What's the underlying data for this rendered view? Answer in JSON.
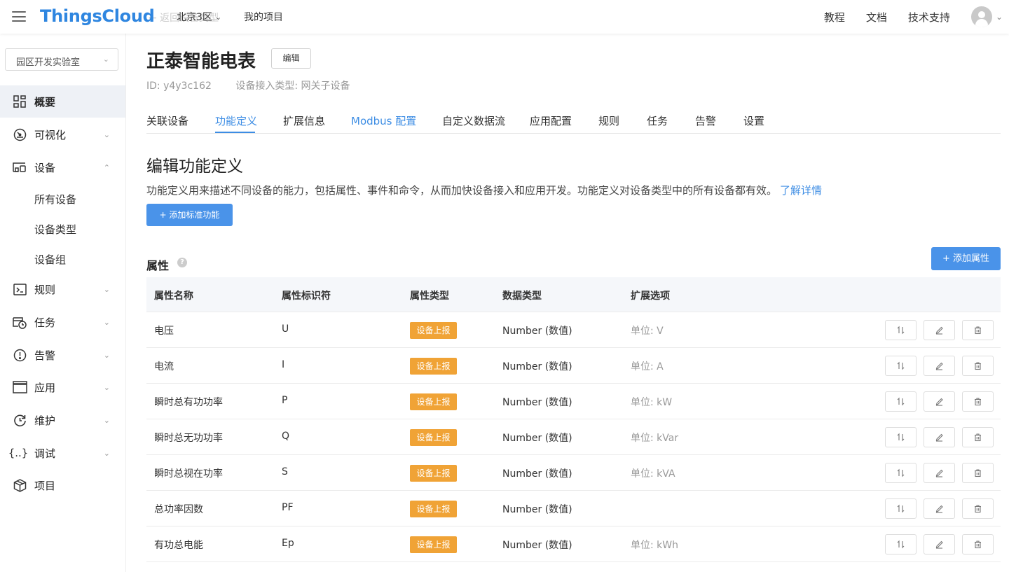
{
  "topbar": {
    "logo": "ThingsCloud",
    "back_text": "← 返回设备类型",
    "region": "北京3区",
    "my_projects": "我的项目",
    "links": [
      "教程",
      "文档",
      "技术支持"
    ]
  },
  "sidebar": {
    "project_select": "园区开发实验室",
    "items": {
      "overview": "概要",
      "visualization": "可视化",
      "devices": "设备",
      "rules": "规则",
      "tasks": "任务",
      "alarms": "告警",
      "apps": "应用",
      "maintenance": "维护",
      "debug": "调试",
      "project": "项目"
    },
    "device_sub": {
      "all": "所有设备",
      "types": "设备类型",
      "groups": "设备组"
    }
  },
  "main": {
    "title": "正泰智能电表",
    "edit_label": "编辑",
    "id_text": "ID: y4y3c162",
    "access_type": "设备接入类型: 网关子设备",
    "tabs": {
      "t0": "关联设备",
      "t1": "功能定义",
      "t2": "扩展信息",
      "t3": "Modbus 配置",
      "t4": "自定义数据流",
      "t5": "应用配置",
      "t6": "规则",
      "t7": "任务",
      "t8": "告警",
      "t9": "设置"
    },
    "section_title": "编辑功能定义",
    "description": "功能定义用来描述不同设备的能力，包括属性、事件和命令，从而加快设备接入和应用开发。功能定义对设备类型中的所有设备都有效。",
    "learn_more": "了解详情",
    "add_standard": "+ 添加标准功能",
    "properties_title": "属性",
    "add_property": "+ 添加属性",
    "columns": {
      "name": "属性名称",
      "identifier": "属性标识符",
      "prop_type": "属性类型",
      "data_type": "数据类型",
      "options": "扩展选项"
    },
    "rows": [
      {
        "name": "电压",
        "id": "U",
        "type": "设备上报",
        "dtype": "Number (数值)",
        "unit": "单位: V"
      },
      {
        "name": "电流",
        "id": "I",
        "type": "设备上报",
        "dtype": "Number (数值)",
        "unit": "单位: A"
      },
      {
        "name": "瞬时总有功功率",
        "id": "P",
        "type": "设备上报",
        "dtype": "Number (数值)",
        "unit": "单位: kW"
      },
      {
        "name": "瞬时总无功功率",
        "id": "Q",
        "type": "设备上报",
        "dtype": "Number (数值)",
        "unit": "单位: kVar"
      },
      {
        "name": "瞬时总视在功率",
        "id": "S",
        "type": "设备上报",
        "dtype": "Number (数值)",
        "unit": "单位: kVA"
      },
      {
        "name": "总功率因数",
        "id": "PF",
        "type": "设备上报",
        "dtype": "Number (数值)",
        "unit": ""
      },
      {
        "name": "有功总电能",
        "id": "Ep",
        "type": "设备上报",
        "dtype": "Number (数值)",
        "unit": "单位: kWh"
      }
    ]
  },
  "colors": {
    "brand": "#2f86e0",
    "primary_button": "#4a93e9",
    "badge": "#f0a336",
    "active_tab": "#3d8de4"
  }
}
